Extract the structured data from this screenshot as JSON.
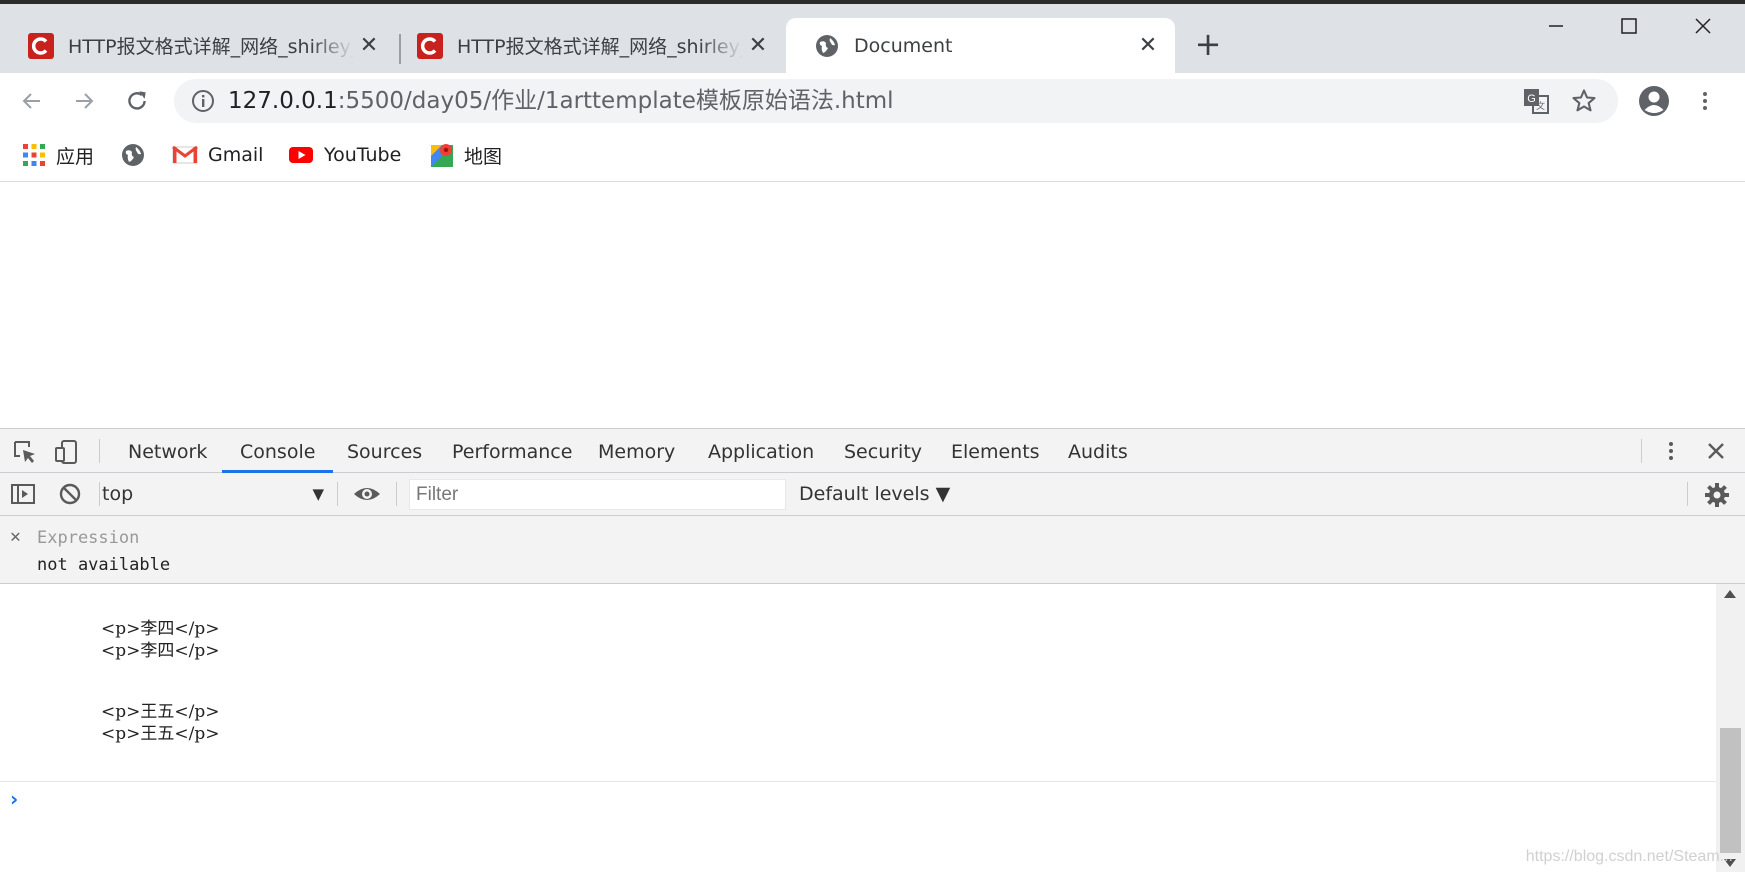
{
  "browser": {
    "tabs": [
      {
        "title": "HTTP报文格式详解_网络_shirley_zx",
        "favicon": "csdn-icon",
        "active": false
      },
      {
        "title": "HTTP报文格式详解_网络_shirley_zx",
        "favicon": "csdn-icon",
        "active": false
      },
      {
        "title": "Document",
        "favicon": "globe-icon",
        "active": true
      }
    ],
    "tab_close_glyph": "✕",
    "new_tab_glyph": "+",
    "address": {
      "host": "127.0.0.1",
      "path": ":5500/day05/作业/1arttemplate模板原始语法.html"
    },
    "bookmarks": [
      {
        "label": "应用",
        "icon": "apps-grid-icon"
      },
      {
        "label": "",
        "icon": "globe-icon"
      },
      {
        "label": "Gmail",
        "icon": "gmail-icon"
      },
      {
        "label": "YouTube",
        "icon": "youtube-icon"
      },
      {
        "label": "地图",
        "icon": "maps-icon"
      }
    ]
  },
  "devtools": {
    "tabs": [
      "Network",
      "Console",
      "Sources",
      "Performance",
      "Memory",
      "Application",
      "Security",
      "Elements",
      "Audits"
    ],
    "active_tab": "Console",
    "console_toolbar": {
      "context": "top",
      "filter_placeholder": "Filter",
      "levels": "Default levels ▼"
    },
    "live_expression": {
      "label": "Expression",
      "value": "not available"
    },
    "output_lines": [
      "<p>李四</p>",
      "<p>李四</p>",
      "<p>王五</p>",
      "<p>王五</p>"
    ],
    "prompt_glyph": "›"
  },
  "watermark": "https://blog.csdn.net/Steam...",
  "colors": {
    "tabbar_bg": "#dee1e6",
    "accent_blue": "#1a73e8",
    "csdn_red": "#c9211e",
    "devtools_bg": "#f3f3f3"
  }
}
